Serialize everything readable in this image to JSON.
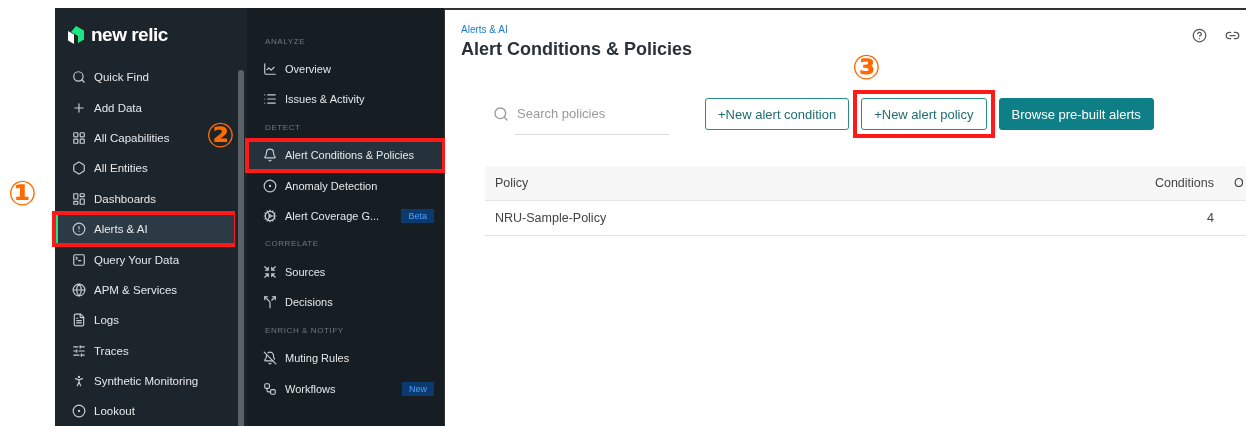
{
  "brand": {
    "name": "new relic"
  },
  "nav": {
    "items": [
      {
        "label": "Quick Find",
        "selected": false,
        "highlighted": false
      },
      {
        "label": "Add Data",
        "selected": false,
        "highlighted": false
      },
      {
        "label": "All Capabilities",
        "selected": false,
        "highlighted": false
      },
      {
        "label": "All Entities",
        "selected": false,
        "highlighted": false
      },
      {
        "label": "Dashboards",
        "selected": false,
        "highlighted": false
      },
      {
        "label": "Alerts & AI",
        "selected": true,
        "highlighted": true
      },
      {
        "label": "Query Your Data",
        "selected": false,
        "highlighted": false
      },
      {
        "label": "APM & Services",
        "selected": false,
        "highlighted": false
      },
      {
        "label": "Logs",
        "selected": false,
        "highlighted": false
      },
      {
        "label": "Traces",
        "selected": false,
        "highlighted": false
      },
      {
        "label": "Synthetic Monitoring",
        "selected": false,
        "highlighted": false
      },
      {
        "label": "Lookout",
        "selected": false,
        "highlighted": false
      }
    ]
  },
  "subnav": {
    "entries": [
      {
        "kind": "heading",
        "label": "ANALYZE"
      },
      {
        "kind": "item",
        "label": "Overview",
        "selected": false,
        "highlighted": false
      },
      {
        "kind": "item",
        "label": "Issues & Activity",
        "selected": false,
        "highlighted": false
      },
      {
        "kind": "heading",
        "label": "DETECT"
      },
      {
        "kind": "item",
        "label": "Alert Conditions & Policies",
        "selected": true,
        "highlighted": true
      },
      {
        "kind": "item",
        "label": "Anomaly Detection",
        "selected": false,
        "highlighted": false
      },
      {
        "kind": "item",
        "label": "Alert Coverage G...",
        "selected": false,
        "highlighted": false,
        "badge": "Beta"
      },
      {
        "kind": "heading",
        "label": "CORRELATE"
      },
      {
        "kind": "item",
        "label": "Sources",
        "selected": false,
        "highlighted": false
      },
      {
        "kind": "item",
        "label": "Decisions",
        "selected": false,
        "highlighted": false
      },
      {
        "kind": "heading",
        "label": "ENRICH & NOTIFY"
      },
      {
        "kind": "item",
        "label": "Muting Rules",
        "selected": false,
        "highlighted": false
      },
      {
        "kind": "item",
        "label": "Workflows",
        "selected": false,
        "highlighted": false,
        "badge": "New"
      }
    ]
  },
  "page": {
    "breadcrumb": "Alerts & AI",
    "title": "Alert Conditions & Policies"
  },
  "toolbar": {
    "search": {
      "placeholder": "Search policies"
    },
    "buttons": [
      {
        "label": "+New alert condition",
        "kind": "outline",
        "highlighted": false
      },
      {
        "label": "+New alert policy",
        "kind": "outline",
        "highlighted": true
      },
      {
        "label": "Browse pre-built alerts",
        "kind": "primary",
        "highlighted": false
      }
    ]
  },
  "table": {
    "columns": [
      "Policy",
      "Conditions",
      "O"
    ],
    "rows": [
      [
        "NRU-Sample-Policy",
        "4",
        ""
      ]
    ]
  },
  "annotations": [
    {
      "label": "①"
    },
    {
      "label": "②"
    },
    {
      "label": "③"
    }
  ]
}
